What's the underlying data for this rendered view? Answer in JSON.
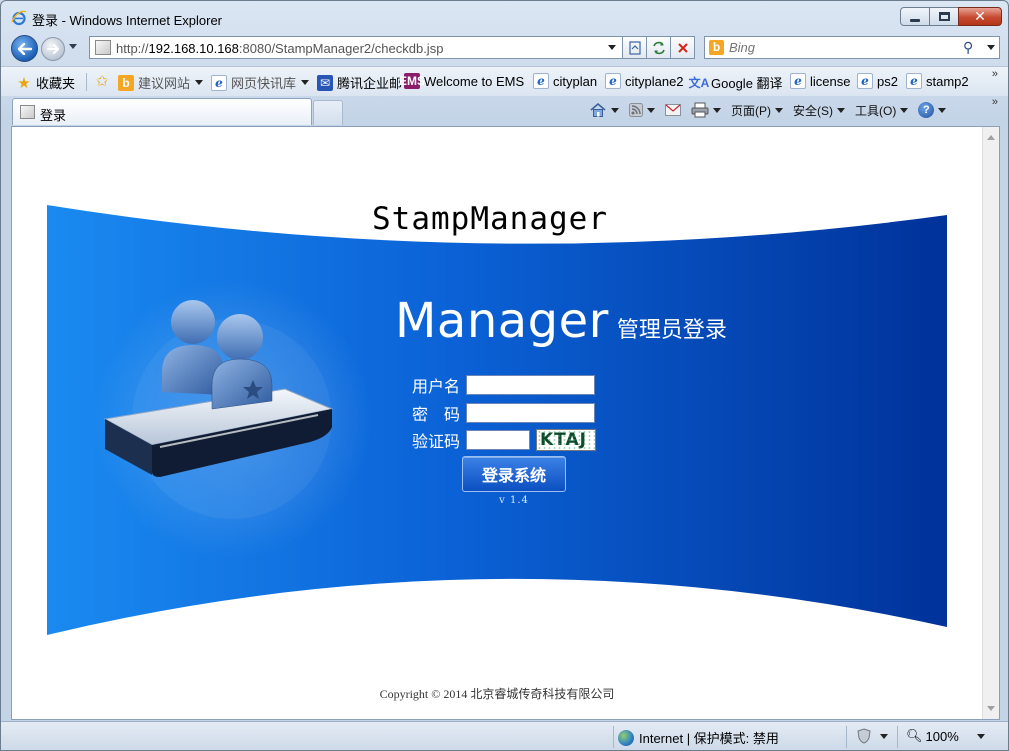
{
  "window": {
    "title": "登录 - Windows Internet Explorer",
    "controls": {
      "minimize": "minimize",
      "maximize": "maximize",
      "close": "close"
    }
  },
  "address": {
    "prefix": "http://",
    "host": "192.168.10.168",
    "rest": ":8080/StampManager2/checkdb.jsp"
  },
  "search": {
    "placeholder": "Bing",
    "provider_icon": "b"
  },
  "favorites": {
    "label": "收藏夹",
    "items": [
      {
        "label": "建议网站",
        "icon": "bing-icon",
        "dropdown": true
      },
      {
        "label": "网页快讯库",
        "icon": "ie-icon",
        "dropdown": true
      },
      {
        "label": "腾讯企业邮",
        "icon": "tencent-icon"
      },
      {
        "label": "Welcome to EMS",
        "icon": "ems-icon"
      },
      {
        "label": "cityplan",
        "icon": "ie-icon"
      },
      {
        "label": "cityplane2",
        "icon": "ie-icon"
      },
      {
        "label": "Google 翻译",
        "icon": "translate-icon"
      },
      {
        "label": "license",
        "icon": "ie-icon"
      },
      {
        "label": "ps2",
        "icon": "ie-icon"
      },
      {
        "label": "stamp2",
        "icon": "ie-icon"
      }
    ],
    "more": "»"
  },
  "tab": {
    "label": "登录"
  },
  "commands": {
    "page": "页面(P)",
    "safety": "安全(S)",
    "tools": "工具(O)"
  },
  "page": {
    "brand": "StampManager",
    "heading_big": "Manager",
    "heading_small": "管理员登录",
    "fields": {
      "username_label": "用户名",
      "username_value": "",
      "password_label": "密　码",
      "password_value": "",
      "captcha_label": "验证码",
      "captcha_value": "",
      "captcha_text": "KTAJ"
    },
    "login_button": "登录系统",
    "version": "v 1.4",
    "copyright": "Copyright © 2014 北京睿城传奇科技有限公司"
  },
  "status": {
    "zone": "Internet | 保护模式: 禁用",
    "zoom": "100%"
  },
  "colors": {
    "banner_light": "#1a8af0",
    "banner_dark": "#00329a",
    "button": "#1560d0"
  }
}
